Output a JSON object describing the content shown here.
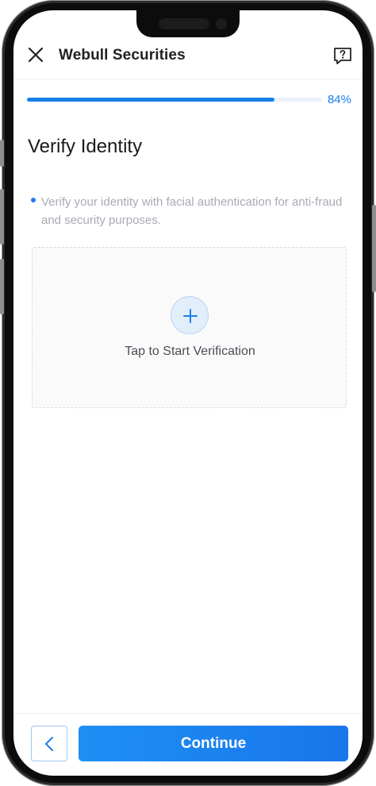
{
  "header": {
    "title": "Webull Securities",
    "close_icon": "close-icon",
    "help_icon": "help-chat-icon"
  },
  "progress": {
    "percent": 84,
    "label": "84%"
  },
  "page": {
    "title": "Verify Identity",
    "description": "Verify your identity with facial authentication for anti-fraud and security purposes."
  },
  "verification": {
    "label": "Tap to Start Verification",
    "icon": "plus-icon"
  },
  "footer": {
    "back_icon": "chevron-left-icon",
    "continue_label": "Continue"
  },
  "colors": {
    "accent": "#1a7fe8",
    "muted_text": "#a7abb3"
  }
}
